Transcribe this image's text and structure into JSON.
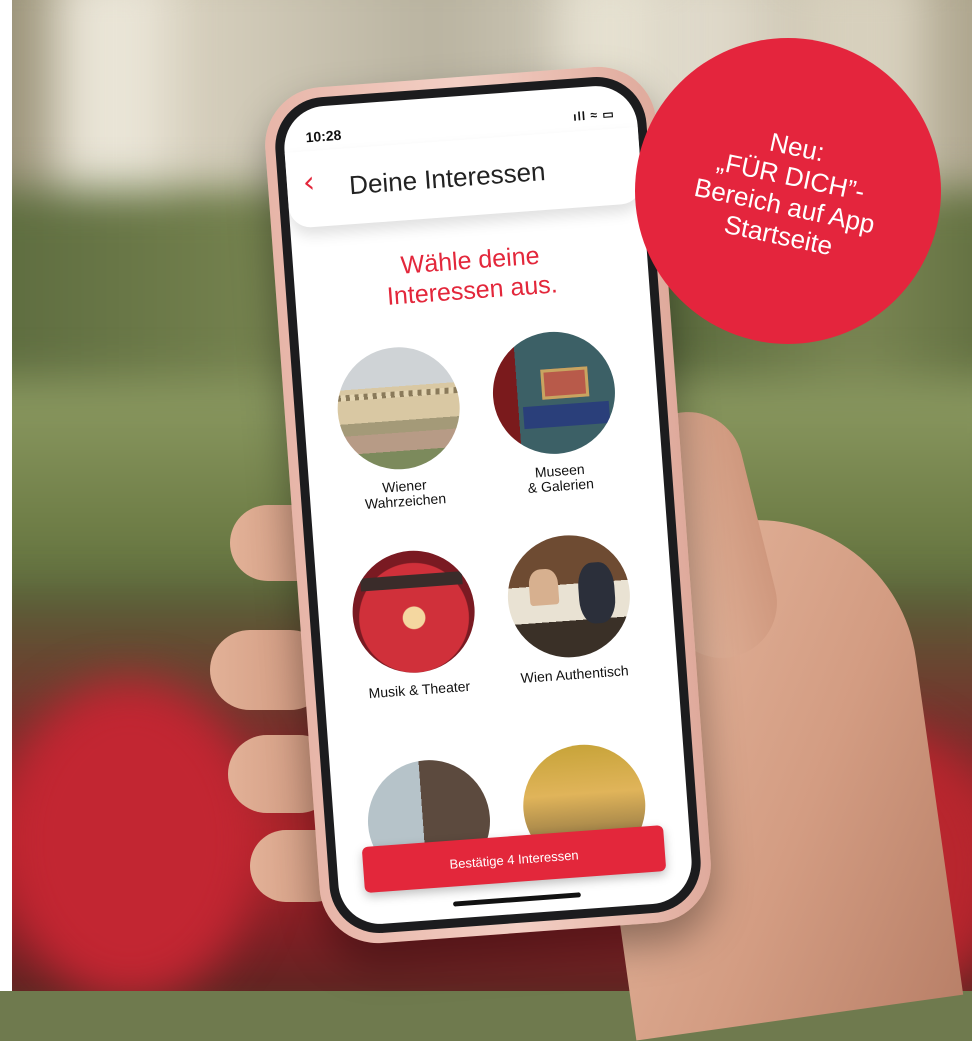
{
  "status_bar": {
    "time": "10:28",
    "icons": "ıll ≈ ▭"
  },
  "header": {
    "title": "Deine Interessen",
    "back_icon": "chevron-left-icon"
  },
  "subtitle": {
    "line1": "Wähle deine",
    "line2": "Interessen aus."
  },
  "interests": [
    {
      "label": "Wiener\nWahrzeichen"
    },
    {
      "label": "Museen\n& Galerien"
    },
    {
      "label": "Musik & Theater"
    },
    {
      "label": "Wien Authentisch"
    }
  ],
  "confirm_button": {
    "label": "Bestätige 4 Interessen"
  },
  "promo": {
    "line1": "Neu:",
    "line2": "„FÜR DICH”-",
    "line3": "Bereich auf App",
    "line4": "Startseite"
  },
  "colors": {
    "accent": "#e3273b"
  }
}
